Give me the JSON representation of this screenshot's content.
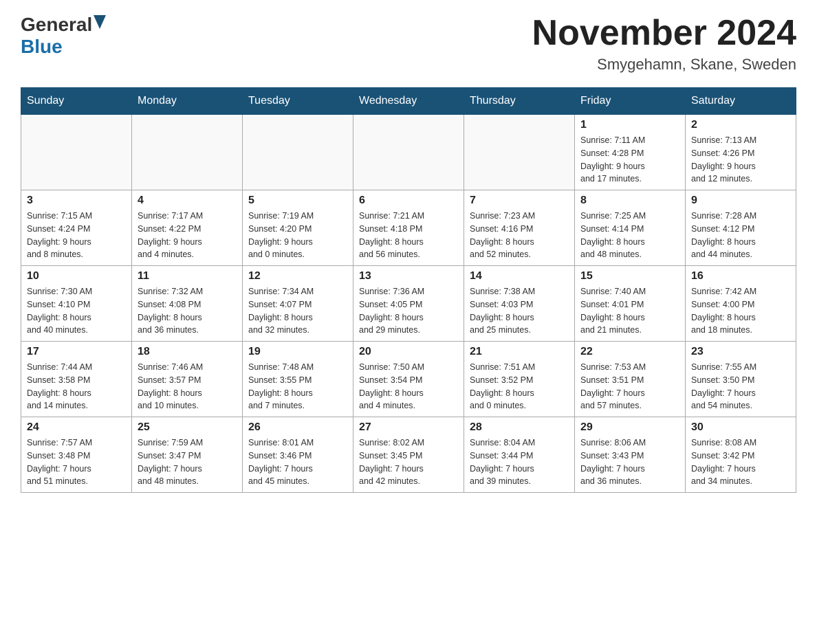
{
  "header": {
    "logo_general": "General",
    "logo_blue": "Blue",
    "month_title": "November 2024",
    "location": "Smygehamn, Skane, Sweden"
  },
  "days_of_week": [
    "Sunday",
    "Monday",
    "Tuesday",
    "Wednesday",
    "Thursday",
    "Friday",
    "Saturday"
  ],
  "weeks": [
    [
      {
        "day": "",
        "info": ""
      },
      {
        "day": "",
        "info": ""
      },
      {
        "day": "",
        "info": ""
      },
      {
        "day": "",
        "info": ""
      },
      {
        "day": "",
        "info": ""
      },
      {
        "day": "1",
        "info": "Sunrise: 7:11 AM\nSunset: 4:28 PM\nDaylight: 9 hours\nand 17 minutes."
      },
      {
        "day": "2",
        "info": "Sunrise: 7:13 AM\nSunset: 4:26 PM\nDaylight: 9 hours\nand 12 minutes."
      }
    ],
    [
      {
        "day": "3",
        "info": "Sunrise: 7:15 AM\nSunset: 4:24 PM\nDaylight: 9 hours\nand 8 minutes."
      },
      {
        "day": "4",
        "info": "Sunrise: 7:17 AM\nSunset: 4:22 PM\nDaylight: 9 hours\nand 4 minutes."
      },
      {
        "day": "5",
        "info": "Sunrise: 7:19 AM\nSunset: 4:20 PM\nDaylight: 9 hours\nand 0 minutes."
      },
      {
        "day": "6",
        "info": "Sunrise: 7:21 AM\nSunset: 4:18 PM\nDaylight: 8 hours\nand 56 minutes."
      },
      {
        "day": "7",
        "info": "Sunrise: 7:23 AM\nSunset: 4:16 PM\nDaylight: 8 hours\nand 52 minutes."
      },
      {
        "day": "8",
        "info": "Sunrise: 7:25 AM\nSunset: 4:14 PM\nDaylight: 8 hours\nand 48 minutes."
      },
      {
        "day": "9",
        "info": "Sunrise: 7:28 AM\nSunset: 4:12 PM\nDaylight: 8 hours\nand 44 minutes."
      }
    ],
    [
      {
        "day": "10",
        "info": "Sunrise: 7:30 AM\nSunset: 4:10 PM\nDaylight: 8 hours\nand 40 minutes."
      },
      {
        "day": "11",
        "info": "Sunrise: 7:32 AM\nSunset: 4:08 PM\nDaylight: 8 hours\nand 36 minutes."
      },
      {
        "day": "12",
        "info": "Sunrise: 7:34 AM\nSunset: 4:07 PM\nDaylight: 8 hours\nand 32 minutes."
      },
      {
        "day": "13",
        "info": "Sunrise: 7:36 AM\nSunset: 4:05 PM\nDaylight: 8 hours\nand 29 minutes."
      },
      {
        "day": "14",
        "info": "Sunrise: 7:38 AM\nSunset: 4:03 PM\nDaylight: 8 hours\nand 25 minutes."
      },
      {
        "day": "15",
        "info": "Sunrise: 7:40 AM\nSunset: 4:01 PM\nDaylight: 8 hours\nand 21 minutes."
      },
      {
        "day": "16",
        "info": "Sunrise: 7:42 AM\nSunset: 4:00 PM\nDaylight: 8 hours\nand 18 minutes."
      }
    ],
    [
      {
        "day": "17",
        "info": "Sunrise: 7:44 AM\nSunset: 3:58 PM\nDaylight: 8 hours\nand 14 minutes."
      },
      {
        "day": "18",
        "info": "Sunrise: 7:46 AM\nSunset: 3:57 PM\nDaylight: 8 hours\nand 10 minutes."
      },
      {
        "day": "19",
        "info": "Sunrise: 7:48 AM\nSunset: 3:55 PM\nDaylight: 8 hours\nand 7 minutes."
      },
      {
        "day": "20",
        "info": "Sunrise: 7:50 AM\nSunset: 3:54 PM\nDaylight: 8 hours\nand 4 minutes."
      },
      {
        "day": "21",
        "info": "Sunrise: 7:51 AM\nSunset: 3:52 PM\nDaylight: 8 hours\nand 0 minutes."
      },
      {
        "day": "22",
        "info": "Sunrise: 7:53 AM\nSunset: 3:51 PM\nDaylight: 7 hours\nand 57 minutes."
      },
      {
        "day": "23",
        "info": "Sunrise: 7:55 AM\nSunset: 3:50 PM\nDaylight: 7 hours\nand 54 minutes."
      }
    ],
    [
      {
        "day": "24",
        "info": "Sunrise: 7:57 AM\nSunset: 3:48 PM\nDaylight: 7 hours\nand 51 minutes."
      },
      {
        "day": "25",
        "info": "Sunrise: 7:59 AM\nSunset: 3:47 PM\nDaylight: 7 hours\nand 48 minutes."
      },
      {
        "day": "26",
        "info": "Sunrise: 8:01 AM\nSunset: 3:46 PM\nDaylight: 7 hours\nand 45 minutes."
      },
      {
        "day": "27",
        "info": "Sunrise: 8:02 AM\nSunset: 3:45 PM\nDaylight: 7 hours\nand 42 minutes."
      },
      {
        "day": "28",
        "info": "Sunrise: 8:04 AM\nSunset: 3:44 PM\nDaylight: 7 hours\nand 39 minutes."
      },
      {
        "day": "29",
        "info": "Sunrise: 8:06 AM\nSunset: 3:43 PM\nDaylight: 7 hours\nand 36 minutes."
      },
      {
        "day": "30",
        "info": "Sunrise: 8:08 AM\nSunset: 3:42 PM\nDaylight: 7 hours\nand 34 minutes."
      }
    ]
  ]
}
